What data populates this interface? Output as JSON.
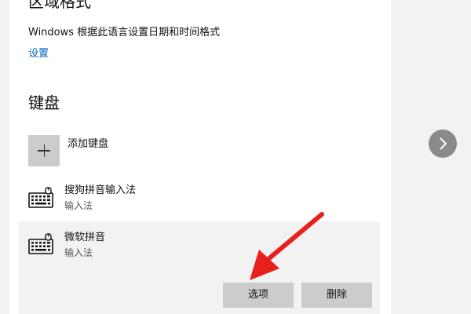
{
  "region_format": {
    "title": "区域格式",
    "description": "Windows 根据此语言设置日期和时间格式",
    "link": "设置"
  },
  "keyboard": {
    "title": "键盘",
    "add_label": "添加键盘",
    "items": [
      {
        "name": "搜狗拼音输入法",
        "type": "输入法",
        "icon": "keyboard-icon"
      },
      {
        "name": "微软拼音",
        "type": "输入法",
        "icon": "keyboard-icon"
      }
    ],
    "options_label": "选项",
    "remove_label": "删除"
  },
  "side_arrow_icon": "chevron-right-icon",
  "annotation_color": "#e8201c"
}
